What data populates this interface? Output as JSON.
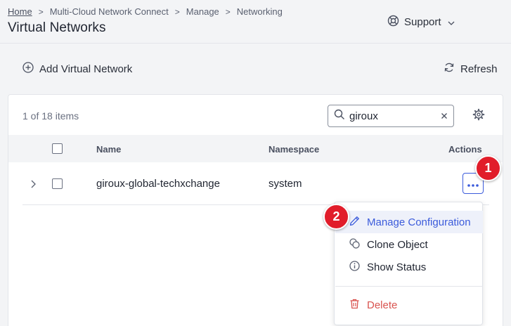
{
  "breadcrumb": {
    "items": [
      "Home",
      "Multi-Cloud Network Connect",
      "Manage",
      "Networking"
    ],
    "separator": ">"
  },
  "page": {
    "title": "Virtual Networks"
  },
  "support": {
    "label": "Support",
    "icon": "lifebuoy-icon"
  },
  "toolbar": {
    "add_label": "Add Virtual Network",
    "refresh_label": "Refresh"
  },
  "table": {
    "count_text": "1 of 18 items",
    "search": {
      "value": "giroux"
    },
    "columns": {
      "name": "Name",
      "namespace": "Namespace",
      "actions": "Actions"
    },
    "rows": [
      {
        "name": "giroux-global-techxchange",
        "namespace": "system"
      }
    ]
  },
  "menu": {
    "items": [
      {
        "label": "Manage Configuration",
        "icon": "pencil-icon",
        "state": "hover"
      },
      {
        "label": "Clone Object",
        "icon": "clone-icon"
      },
      {
        "label": "Show Status",
        "icon": "info-icon"
      },
      {
        "label": "Delete",
        "icon": "trash-icon",
        "style": "danger"
      }
    ]
  },
  "annotations": {
    "step1": "1",
    "step2": "2"
  },
  "colors": {
    "accent": "#3b5bdb",
    "danger": "#d9534f",
    "badge": "#e11d2a",
    "background": "#f3f4f6"
  }
}
